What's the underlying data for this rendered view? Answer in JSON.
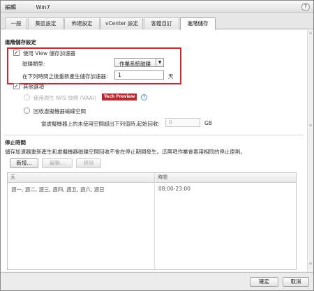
{
  "window": {
    "title_prefix": "編輯",
    "title_name": "Win7",
    "help_label": "?"
  },
  "tabs": [
    {
      "label": "一般"
    },
    {
      "label": "集區設定"
    },
    {
      "label": "佈建設定"
    },
    {
      "label": "vCenter 設定"
    },
    {
      "label": "客體自訂"
    },
    {
      "label": "進階儲存"
    }
  ],
  "advanced_storage": {
    "section_title": "進階儲存設定",
    "use_view_accelerator": {
      "label": "使用 View 儲存加速器",
      "checked": true
    },
    "disk_type": {
      "label": "磁碟類型:",
      "value": "作業系統磁碟"
    },
    "regenerate": {
      "label": "在下列時間之後重新產生儲存加速器:",
      "value": "1",
      "unit": "天"
    },
    "other_options": {
      "label": "其他選項",
      "checked": true
    },
    "native_nfs": {
      "label": "使用原生 NFS 快照 (VAAI)",
      "badge": "Tech Preview",
      "info": "?"
    },
    "reclaim": {
      "label": "回收虛擬機器磁碟空間"
    },
    "reclaim_threshold": {
      "label": "當虛擬機器上的未使用空間超出下列值時,起始回收:",
      "value": "0",
      "unit": "GB"
    }
  },
  "blackout": {
    "section_title": "停止時間",
    "description": "儲存加速器重新產生和虛擬機器磁碟空間回收不會在停止期間發生。這兩項作業會套用相同的停止原則。",
    "buttons": {
      "add": "新增...",
      "edit": "編輯...",
      "remove": "移除"
    },
    "columns": [
      "天",
      "時間"
    ],
    "rows": [
      {
        "days": "週一, 週二, 週三, 週四, 週五, 週六, 週日",
        "time": "08:00-23:00"
      }
    ]
  },
  "footer": {
    "ok_label": "確定",
    "cancel_label": "取消"
  },
  "colors": {
    "highlight": "#d9232d",
    "tech_preview": "#c0272d"
  }
}
